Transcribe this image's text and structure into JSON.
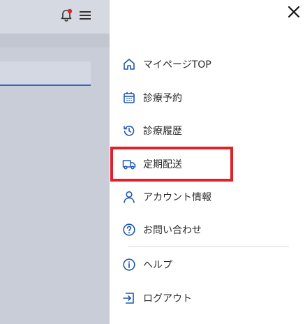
{
  "icons": {
    "bell": "bell-icon",
    "hamburger": "hamburger-menu-icon",
    "close": "close-icon"
  },
  "colors": {
    "accent": "#3b63c4",
    "icon_blue": "#1e56b6",
    "badge_red": "#d62a2a",
    "highlight_red": "#e0212a"
  },
  "menu": {
    "items": [
      {
        "label": "マイページTOP",
        "icon": "home-icon"
      },
      {
        "label": "診療予約",
        "icon": "calendar-icon"
      },
      {
        "label": "診療履歴",
        "icon": "history-icon"
      },
      {
        "label": "定期配送",
        "icon": "truck-icon",
        "highlighted": true
      },
      {
        "label": "アカウント情報",
        "icon": "user-icon"
      },
      {
        "label": "お問い合わせ",
        "icon": "question-icon"
      },
      {
        "label": "ヘルプ",
        "icon": "info-icon"
      },
      {
        "label": "ログアウト",
        "icon": "logout-icon"
      }
    ]
  }
}
